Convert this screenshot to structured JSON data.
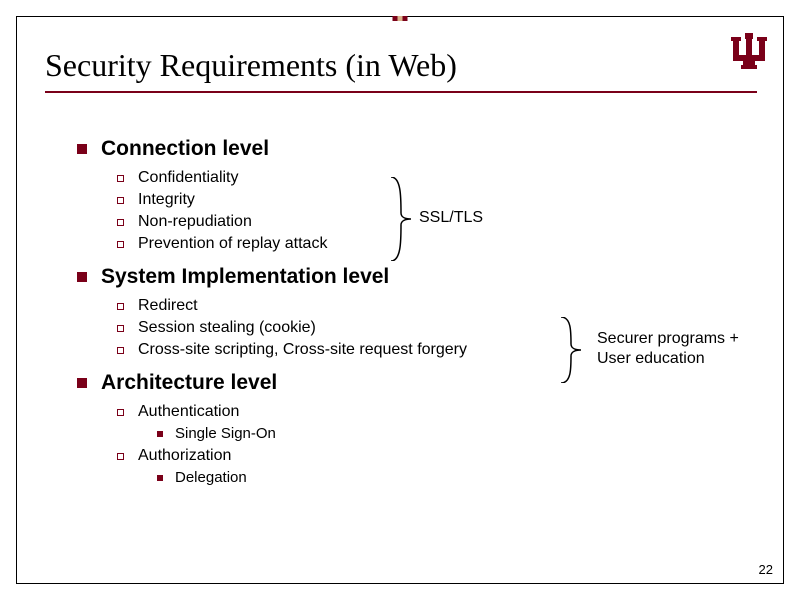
{
  "title": "Security Requirements (in Web)",
  "page_number": "22",
  "sections": [
    {
      "heading": "Connection level",
      "items": [
        "Confidentiality",
        "Integrity",
        "Non-repudiation",
        "Prevention of replay attack"
      ]
    },
    {
      "heading": "System Implementation level",
      "items": [
        "Redirect",
        "Session stealing (cookie)",
        "Cross-site scripting, Cross-site request forgery"
      ]
    },
    {
      "heading": "Architecture level",
      "subsections": [
        {
          "label": "Authentication",
          "children": [
            "Single Sign-On"
          ]
        },
        {
          "label": "Authorization",
          "children": [
            "Delegation"
          ]
        }
      ]
    }
  ],
  "annotations": {
    "brace1_label": "SSL/TLS",
    "brace2_line1": "Securer programs +",
    "brace2_line2": "User education"
  }
}
